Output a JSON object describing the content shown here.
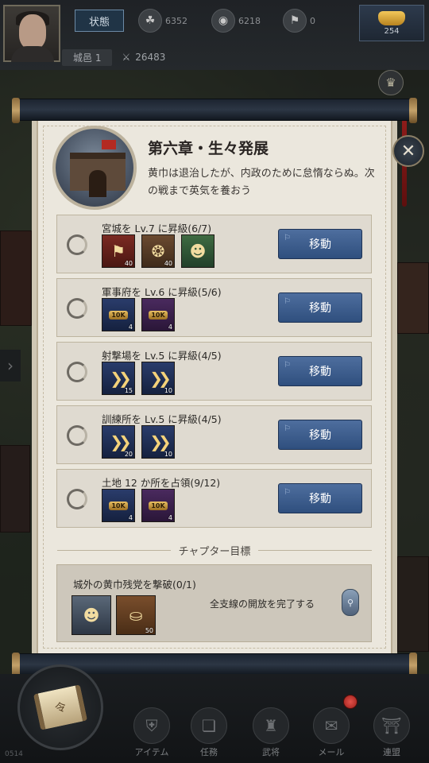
{
  "top_bar": {
    "status_button": "状態",
    "resources": [
      {
        "icon": "grain-icon",
        "value": "6352"
      },
      {
        "icon": "coin-icon",
        "value": "6218"
      },
      {
        "icon": "troops-icon",
        "value": "0"
      }
    ],
    "gold": {
      "icon": "gold-ingot-icon",
      "value": "254"
    },
    "level": "城邑 1",
    "power": "26483"
  },
  "chapter": {
    "title": "第六章・生々発展",
    "description": "黄巾は退治したが、内政のために怠惰ならぬ。次の戦まで英気を養おう"
  },
  "tasks": [
    {
      "title": "宮城を Lv.7 に昇級(6/7)",
      "rewards": [
        {
          "icon": "banner-icon",
          "style": "red",
          "count": "40"
        },
        {
          "icon": "seal-icon",
          "style": "bronze",
          "count": "40"
        },
        {
          "icon": "general-portrait-icon",
          "style": "general",
          "count": ""
        }
      ],
      "button": "移動"
    },
    {
      "title": "軍事府を Lv.6 に昇級(5/6)",
      "rewards": [
        {
          "icon": "10k-coin-icon",
          "style": "blue",
          "label": "10K",
          "count": "4"
        },
        {
          "icon": "10k-grain-icon",
          "style": "purple",
          "label": "10K",
          "count": "4"
        }
      ],
      "button": "移動"
    },
    {
      "title": "射撃場を Lv.5 に昇級(4/5)",
      "rewards": [
        {
          "icon": "speedup-icon",
          "style": "blue",
          "count": "15"
        },
        {
          "icon": "speedup-icon",
          "style": "blue",
          "count": "10"
        }
      ],
      "button": "移動"
    },
    {
      "title": "訓練所を Lv.5 に昇級(4/5)",
      "rewards": [
        {
          "icon": "speedup-icon",
          "style": "blue",
          "count": "20"
        },
        {
          "icon": "speedup-icon",
          "style": "blue",
          "count": "10"
        }
      ],
      "button": "移動"
    },
    {
      "title": "土地 12 か所を占領(9/12)",
      "rewards": [
        {
          "icon": "10k-coin-icon",
          "style": "blue",
          "label": "10K",
          "count": "4"
        },
        {
          "icon": "10k-grain-icon",
          "style": "purple",
          "label": "10K",
          "count": "4"
        }
      ],
      "button": "移動"
    }
  ],
  "goal": {
    "heading": "チャプター目標",
    "title": "城外の黄巾残党を撃破(0/1)",
    "status": "全支線の開放を完了する",
    "rewards": [
      {
        "icon": "general-portrait-icon",
        "style": "general2",
        "count": ""
      },
      {
        "icon": "gold-ingot-icon",
        "style": "gold",
        "count": "50"
      }
    ]
  },
  "bottom_nav": [
    {
      "icon": "armor-icon",
      "label": "アイテム"
    },
    {
      "icon": "book-icon",
      "label": "任務"
    },
    {
      "icon": "general-icon",
      "label": "武将"
    },
    {
      "icon": "mail-icon",
      "label": "メール"
    },
    {
      "icon": "alliance-icon",
      "label": "連盟"
    }
  ],
  "misc": {
    "close_symbol": "✕",
    "quest_scroll_glyph": "令",
    "lock_glyph": "⚲",
    "side_arrow": "›",
    "bottom_number": "0514"
  },
  "colors": {
    "panel_bg": "#ebe7dd",
    "button_blue": "#3e5e8e",
    "task_bg": "#dfdad0"
  }
}
